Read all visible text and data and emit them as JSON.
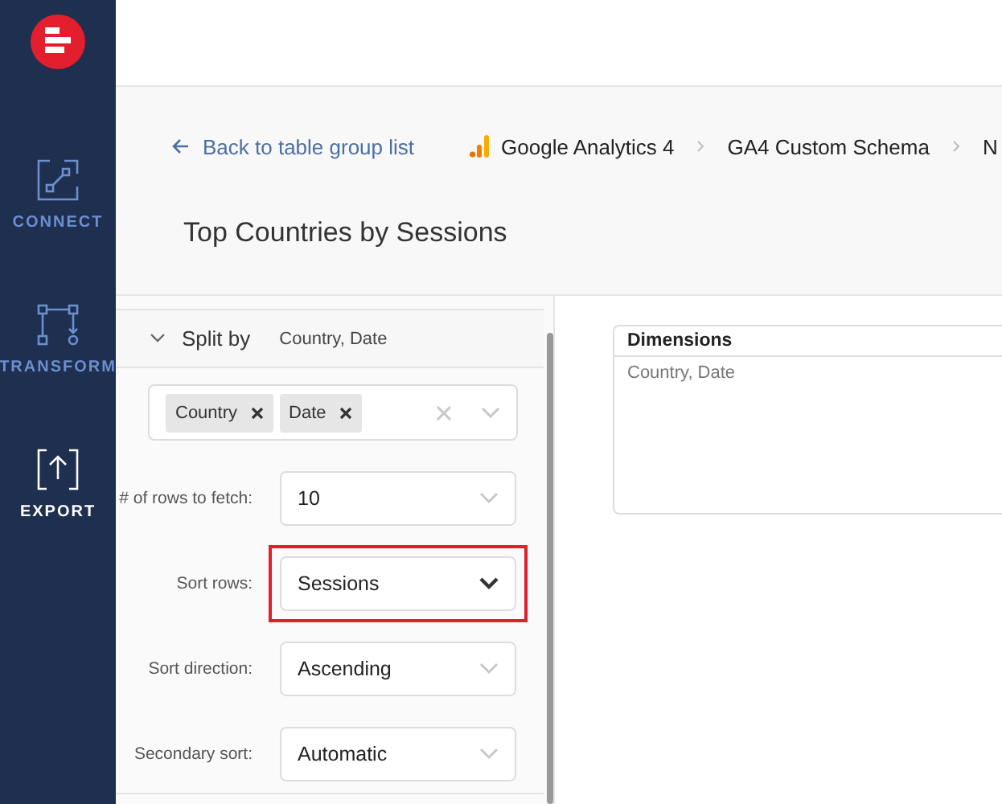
{
  "nav": [
    {
      "label": "CONNECT",
      "kind": "connect",
      "selected": false
    },
    {
      "label": "TRANSFORM",
      "kind": "transform",
      "selected": false
    },
    {
      "label": "EXPORT",
      "kind": "export",
      "selected": true
    }
  ],
  "back_link": "Back to table group list",
  "breadcrumbs": [
    {
      "label": "Google Analytics 4",
      "kind": "analytics"
    },
    {
      "label": "GA4 Custom Schema",
      "kind": "plain"
    },
    {
      "label": "N",
      "kind": "plain"
    }
  ],
  "title": "Top Countries by Sessions",
  "split_by": {
    "label": "Split by",
    "summary": "Country, Date",
    "expanded": true,
    "tags": [
      "Country",
      "Date"
    ]
  },
  "fields": [
    {
      "label": "# of rows to fetch:",
      "value": "10",
      "highlighted": false
    },
    {
      "label": "Sort rows:",
      "value": "Sessions",
      "highlighted": true
    },
    {
      "label": "Sort direction:",
      "value": "Ascending",
      "highlighted": false
    },
    {
      "label": "Secondary sort:",
      "value": "Automatic",
      "highlighted": false
    }
  ],
  "dimensions": {
    "header": "Dimensions",
    "value": "Country, Date"
  }
}
